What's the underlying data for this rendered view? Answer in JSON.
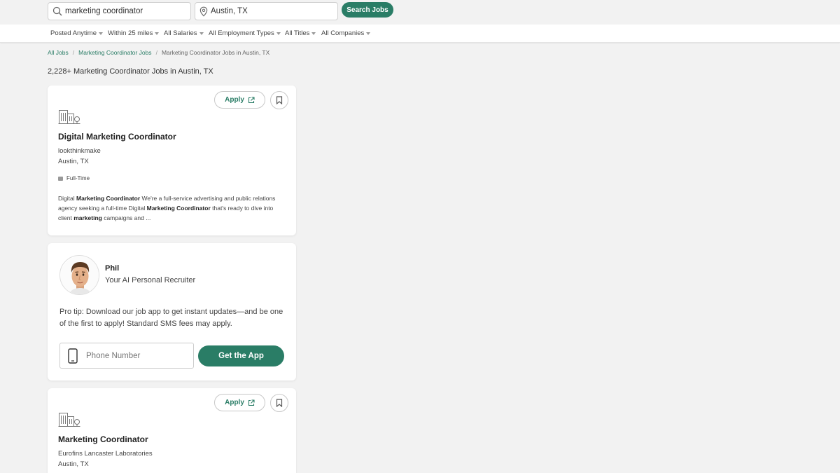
{
  "search": {
    "keyword_value": "marketing coordinator",
    "location_value": "Austin, TX",
    "button_label": "Search Jobs"
  },
  "filters": [
    {
      "label": "Posted Anytime"
    },
    {
      "label": "Within 25 miles"
    },
    {
      "label": "All Salaries"
    },
    {
      "label": "All Employment Types"
    },
    {
      "label": "All Titles"
    },
    {
      "label": "All Companies"
    }
  ],
  "breadcrumb": {
    "items": [
      "All Jobs",
      "Marketing Coordinator Jobs",
      "Marketing Coordinator Jobs in Austin, TX"
    ],
    "separator": "/"
  },
  "results": {
    "count_text": "2,228+ Marketing Coordinator Jobs in Austin, TX"
  },
  "jobs": [
    {
      "apply_label": "Apply",
      "title": "Digital Marketing Coordinator",
      "company": "lookthinkmake",
      "location": "Austin, TX",
      "type": "Full-Time",
      "description_parts": [
        {
          "text": "Digital ",
          "bold": false
        },
        {
          "text": "Marketing Coordinator",
          "bold": true
        },
        {
          "text": " We're a full-service advertising and public relations agency seeking a full-time Digital ",
          "bold": false
        },
        {
          "text": "Marketing Coordinator",
          "bold": true
        },
        {
          "text": " that's ready to dive into client ",
          "bold": false
        },
        {
          "text": "marketing",
          "bold": true
        },
        {
          "text": " campaigns and ...",
          "bold": false
        }
      ]
    },
    {
      "apply_label": "Apply",
      "title": "Marketing Coordinator",
      "company": "Eurofins Lancaster Laboratories",
      "location": "Austin, TX"
    }
  ],
  "recruiter": {
    "name": "Phil",
    "role": "Your AI Personal Recruiter",
    "tip": "Pro tip: Download our job app to get instant updates—and be one of the first to apply! Standard SMS fees may apply.",
    "phone_placeholder": "Phone Number",
    "button_label": "Get the App"
  },
  "colors": {
    "accent": "#2a7d66",
    "background": "#f2f2f2",
    "card": "#ffffff"
  },
  "icons": {
    "search": "search-icon",
    "location": "location-pin-icon",
    "external": "external-link-icon",
    "bookmark": "bookmark-icon",
    "company": "building-icon",
    "job_type": "briefcase-icon",
    "phone": "smartphone-icon"
  }
}
